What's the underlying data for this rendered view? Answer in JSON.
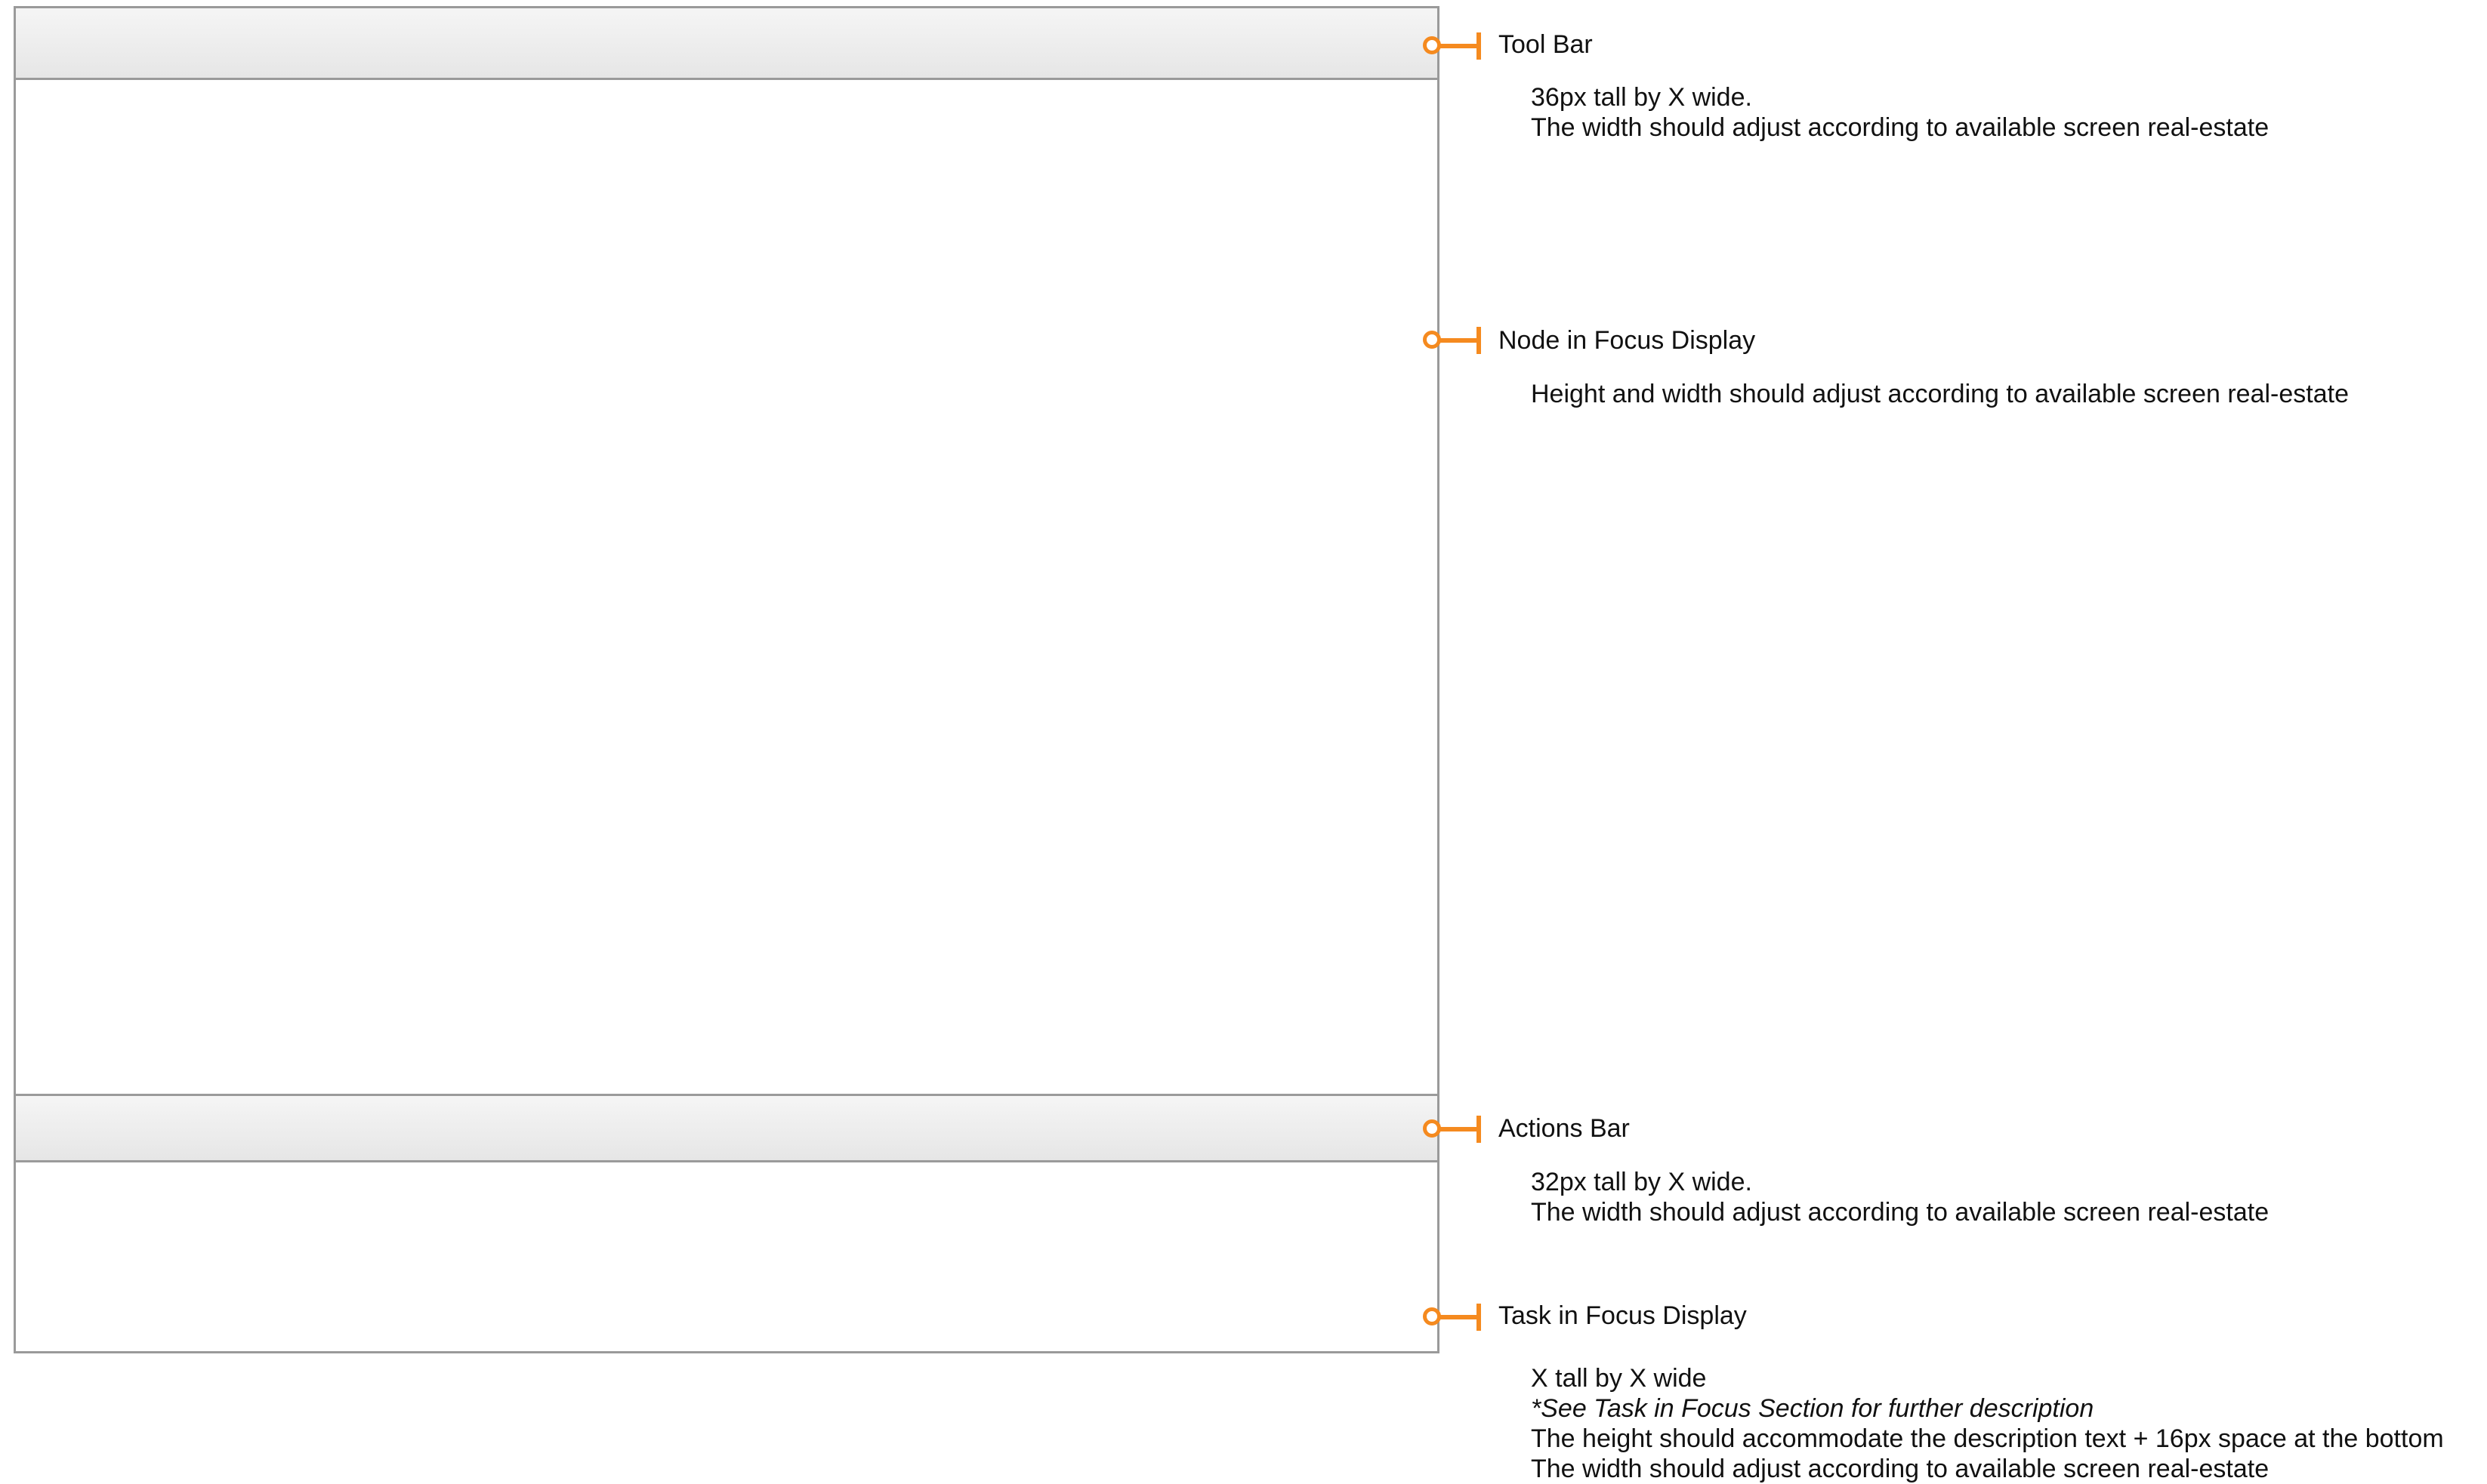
{
  "colors": {
    "accent": "#f58a1f",
    "border": "#9a9a9a",
    "bar_fill": "#e9e9e9"
  },
  "callouts": [
    {
      "title": "Tool Bar",
      "lines": [
        "36px tall by X wide.",
        "The width should adjust according to available screen real-estate"
      ]
    },
    {
      "title": "Node in Focus Display",
      "lines": [
        "Height and width should adjust according to available screen real-estate"
      ]
    },
    {
      "title": "Actions Bar",
      "lines": [
        "32px tall by X wide.",
        "The width should adjust according to available screen real-estate"
      ]
    },
    {
      "title": "Task in Focus Display",
      "lines": [
        "X tall by X wide",
        "*See Task in Focus Section for further description",
        "The height should accommodate the description text + 16px space at the bottom",
        "The width should adjust according to available screen real-estate"
      ]
    }
  ]
}
